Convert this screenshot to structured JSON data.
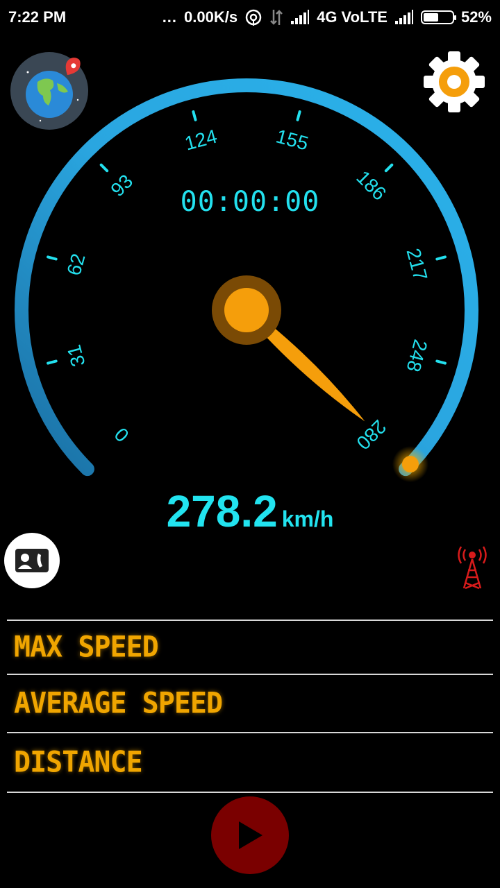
{
  "status_bar": {
    "time": "7:22 PM",
    "dots": "...",
    "net_speed": "0.00K/s",
    "network": "4G VoLTE",
    "battery_percent": "52%",
    "battery_level": 0.52
  },
  "gauge": {
    "timer": "00:00:00",
    "tick_labels": [
      "0",
      "31",
      "62",
      "93",
      "124",
      "155",
      "186",
      "217",
      "248",
      "280"
    ],
    "speed_value": "278.2",
    "speed_unit": "km/h",
    "max": 280,
    "current": 278.2
  },
  "stats": {
    "max_speed_label": "MAX SPEED",
    "average_speed_label": "AVERAGE SPEED",
    "distance_label": "DISTANCE"
  },
  "colors": {
    "gauge_blue": "#2aa6e0",
    "gauge_cyan": "#23e0ee",
    "needle_orange": "#f59e0b",
    "label_orange": "#f0a500",
    "play_red": "#7a0000",
    "tower_red": "#d81b1b"
  },
  "icons": {
    "globe": "globe-location-icon",
    "settings": "gear-icon",
    "contact": "contact-card-icon",
    "tower": "signal-tower-icon",
    "play": "play-icon"
  }
}
